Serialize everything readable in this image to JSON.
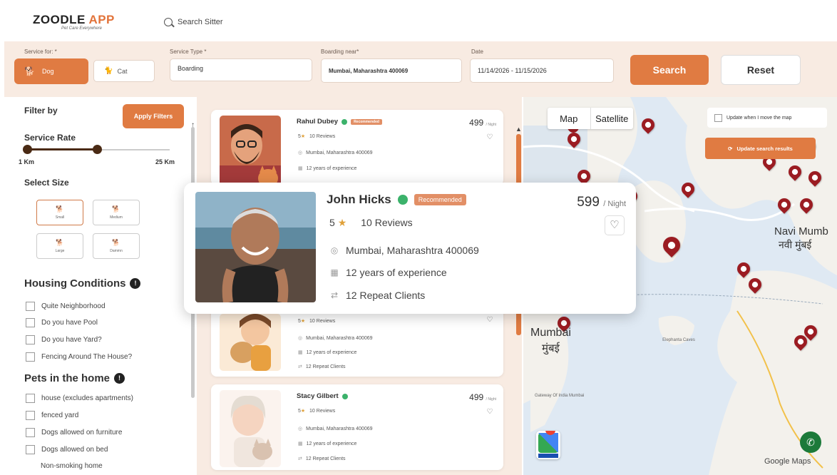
{
  "header": {
    "logo_main": "ZOODLE",
    "logo_app": "APP",
    "tagline": "Pet Care Everywhere",
    "search_placeholder": "Search Sitter"
  },
  "search_bar": {
    "service_for_label": "Service for: *",
    "dog_label": "Dog",
    "cat_label": "Cat",
    "service_type_label": "Service Type *",
    "service_type_value": "Boarding",
    "boarding_near_label": "Boarding near*",
    "boarding_near_value": "Mumbai, Maharashtra 400069",
    "date_label": "Date",
    "date_value": "11/14/2026 - 11/15/2026",
    "search_button": "Search",
    "reset_button": "Reset"
  },
  "filters": {
    "filter_by": "Filter by",
    "apply_button": "Apply Filters",
    "service_rate_title": "Service Rate",
    "rate_min": "1 Km",
    "rate_max": "25 Km",
    "rate_value_fraction": 0.5,
    "select_size_title": "Select Size",
    "sizes": [
      "Small",
      "Medium",
      "Large",
      "Dammn"
    ],
    "selected_size": "Small",
    "housing_title": "Housing Conditions",
    "housing_options": [
      "Quite Neighborhood",
      "Do you have Pool",
      "Do you have Yard?",
      "Fencing Around The House?"
    ],
    "pets_title": "Pets in the home",
    "pets_options": [
      "house (excludes apartments)",
      "fenced yard",
      "Dogs allowed on furniture",
      "Dogs allowed on bed",
      "Non-smoking home"
    ]
  },
  "listings": [
    {
      "name": "Rahul Dubey",
      "badge": "Recommended",
      "price": "499",
      "per": "/ Night",
      "rating": "5",
      "reviews": "10 Reviews",
      "location": "Mumbai, Maharashtra 400069",
      "experience": "12 years of experience"
    },
    {
      "name": "",
      "price": "",
      "rating": "5",
      "reviews": "10 Reviews",
      "location": "Mumbai, Maharashtra 400069",
      "experience": "12 years of experience",
      "repeat": "12 Repeat Clients"
    },
    {
      "name": "Stacy Gilbert",
      "price": "499",
      "per": "/ Night",
      "rating": "5",
      "reviews": "10 Reviews",
      "location": "Mumbai, Maharashtra 400069",
      "experience": "12 years of experience",
      "repeat": "12 Repeat Clients"
    }
  ],
  "popup": {
    "name": "John Hicks",
    "badge": "Recommended",
    "price": "599",
    "per": "/ Night",
    "rating": "5",
    "reviews": "10 Reviews",
    "location": "Mumbai, Maharashtra 400069",
    "experience": "12 years of experience",
    "repeat": "12 Repeat Clients"
  },
  "map": {
    "tab_map": "Map",
    "tab_satellite": "Satellite",
    "update_checkbox": "Update when I move the map",
    "update_results": "Update search results",
    "label_navi": "Navi Mumb",
    "label_navi_hi": "नवी मुंबई",
    "label_mumbai": "Mumbai",
    "label_mumbai_hi": "मुंबई",
    "label_elephanta": "Elephanta Caves",
    "label_gateway": "Gateway Of India Mumbai",
    "label_google": "Google Maps",
    "pin_color": "#9b1c22",
    "water_color": "#dfe9f3",
    "land_color": "#f3f1ec"
  },
  "colors": {
    "accent": "#e07b42",
    "strip_bg": "#f8ebe2",
    "verified": "#3bb26b"
  }
}
